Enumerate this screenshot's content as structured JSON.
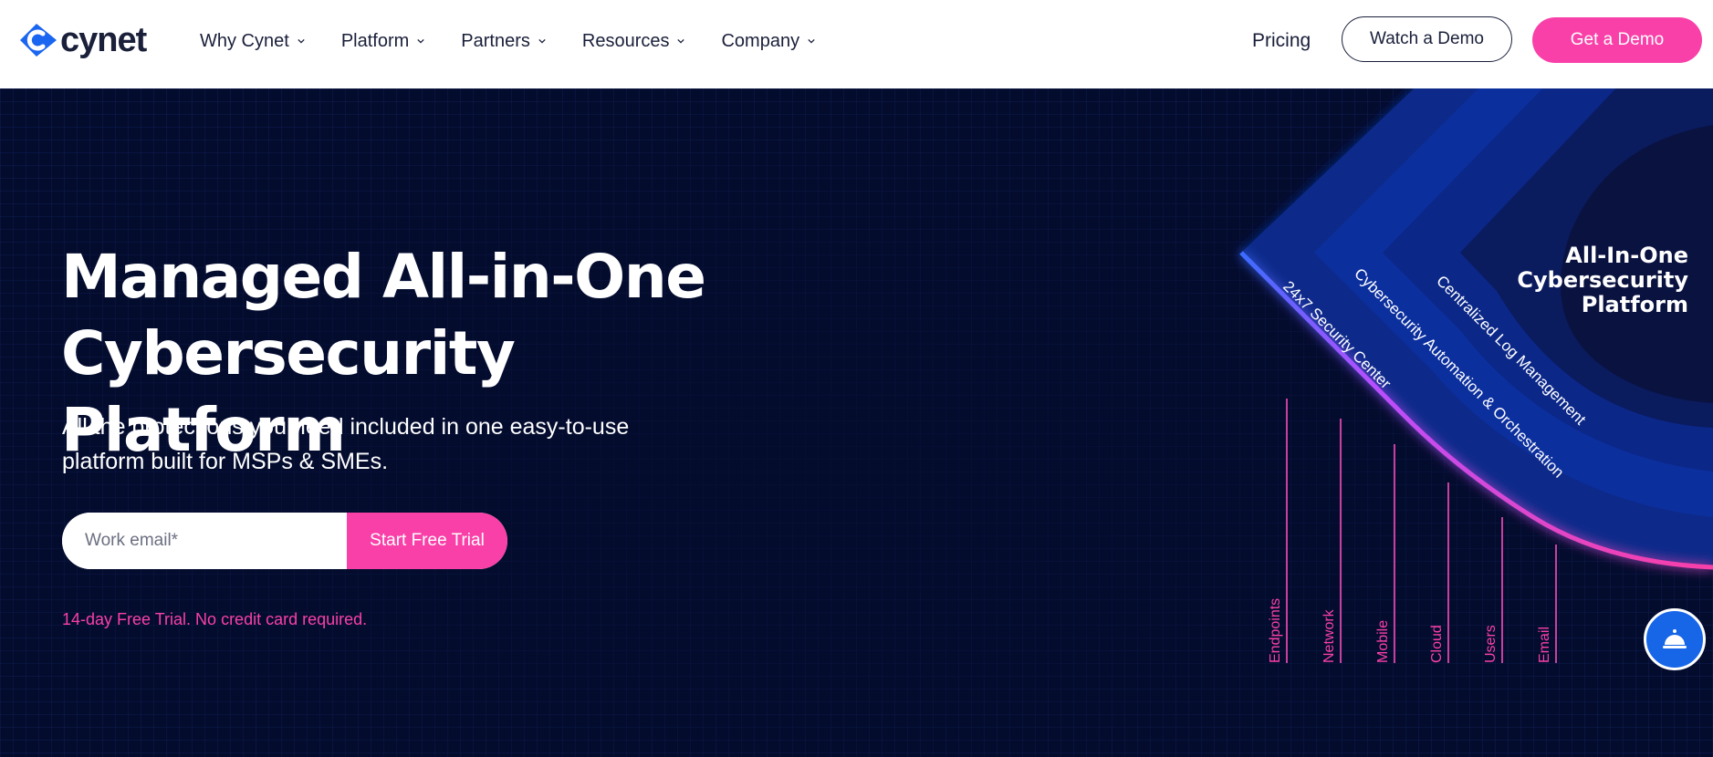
{
  "brand": {
    "name": "cynet",
    "primary": "#1a66f0",
    "accent": "#f940a8",
    "navy": "#040c2e"
  },
  "nav": {
    "items": [
      {
        "label": "Why Cynet",
        "icon": "chevron-down-icon"
      },
      {
        "label": "Platform",
        "icon": "chevron-down-icon"
      },
      {
        "label": "Partners",
        "icon": "chevron-down-icon"
      },
      {
        "label": "Resources",
        "icon": "chevron-down-icon"
      },
      {
        "label": "Company",
        "icon": "chevron-down-icon"
      }
    ],
    "pricing": "Pricing",
    "watch_demo": "Watch a Demo",
    "get_demo": "Get a Demo"
  },
  "hero": {
    "title_line1": "Managed All-in-One",
    "title_line2": "Cybersecurity Platform",
    "subtitle_line1": "All the protections you need included in one easy-to-use",
    "subtitle_line2": "platform built for MSPs & SMEs.",
    "email_placeholder": "Work email*",
    "cta": "Start Free Trial",
    "note": "14-day Free Trial. No credit card required."
  },
  "graphic": {
    "core_line1": "All-In-One",
    "core_line2": "Cybersecurity",
    "core_line3": "Platform",
    "layers": [
      "24x7 Security Center",
      "Cybersecurity Automation & Orchestration",
      "Centralized Log Management"
    ],
    "sources": [
      "Endpoints",
      "Network",
      "Mobile",
      "Cloud",
      "Users",
      "Email"
    ]
  },
  "chat": {
    "icon": "concierge-bell-icon"
  }
}
